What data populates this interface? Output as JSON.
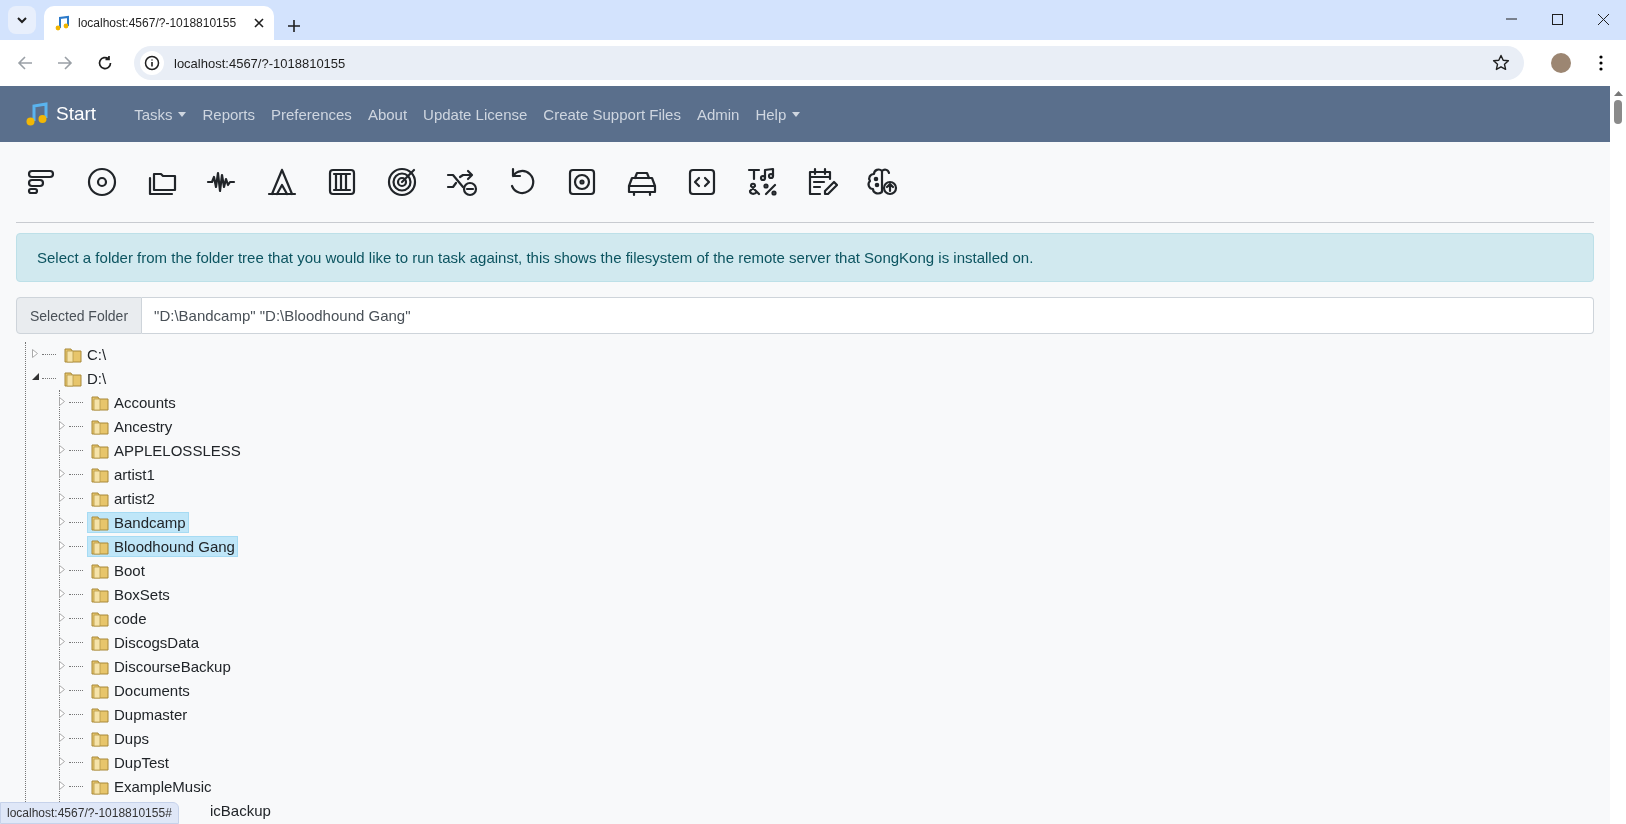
{
  "browser": {
    "tab": {
      "title": "localhost:4567/?-1018810155",
      "selected": true
    },
    "address": "localhost:4567/?-1018810155"
  },
  "navbar": {
    "brand": "Start",
    "items": [
      {
        "label": "Tasks",
        "dropdown": true
      },
      {
        "label": "Reports",
        "dropdown": false
      },
      {
        "label": "Preferences",
        "dropdown": false
      },
      {
        "label": "About",
        "dropdown": false
      },
      {
        "label": "Update License",
        "dropdown": false
      },
      {
        "label": "Create Support Files",
        "dropdown": false
      },
      {
        "label": "Admin",
        "dropdown": false
      },
      {
        "label": "Help",
        "dropdown": true
      }
    ]
  },
  "alert": "Select a folder from the folder tree that you would like to run task against, this shows the filesystem of the remote server that SongKong is installed on.",
  "selected_folder": {
    "label": "Selected Folder",
    "value": "\"D:\\Bandcamp\" \"D:\\Bloodhound Gang\""
  },
  "tree": [
    {
      "label": "C:\\",
      "expanded": false,
      "selected": false
    },
    {
      "label": "D:\\",
      "expanded": true,
      "selected": false,
      "children": [
        {
          "label": "Accounts",
          "selected": false,
          "kind": "folder"
        },
        {
          "label": "Ancestry",
          "selected": false,
          "kind": "folder"
        },
        {
          "label": "APPLELOSSLESS",
          "selected": false,
          "kind": "folder"
        },
        {
          "label": "artist1",
          "selected": false,
          "kind": "folder"
        },
        {
          "label": "artist2",
          "selected": false,
          "kind": "folder"
        },
        {
          "label": "Bandcamp",
          "selected": true,
          "kind": "folder"
        },
        {
          "label": "Bloodhound Gang",
          "selected": true,
          "kind": "folder"
        },
        {
          "label": "Boot",
          "selected": false,
          "kind": "folder"
        },
        {
          "label": "BoxSets",
          "selected": false,
          "kind": "folder"
        },
        {
          "label": "code",
          "selected": false,
          "kind": "folder"
        },
        {
          "label": "DiscogsData",
          "selected": false,
          "kind": "folder"
        },
        {
          "label": "DiscourseBackup",
          "selected": false,
          "kind": "folder"
        },
        {
          "label": "Documents",
          "selected": false,
          "kind": "folder"
        },
        {
          "label": "Dupmaster",
          "selected": false,
          "kind": "folder"
        },
        {
          "label": "Dups",
          "selected": false,
          "kind": "folder"
        },
        {
          "label": "DupTest",
          "selected": false,
          "kind": "folder"
        },
        {
          "label": "ExampleMusic",
          "selected": false,
          "kind": "folder"
        },
        {
          "label": "icBackup",
          "kind": "covered"
        }
      ]
    }
  ],
  "status_bar": "localhost:4567/?-1018810155#"
}
